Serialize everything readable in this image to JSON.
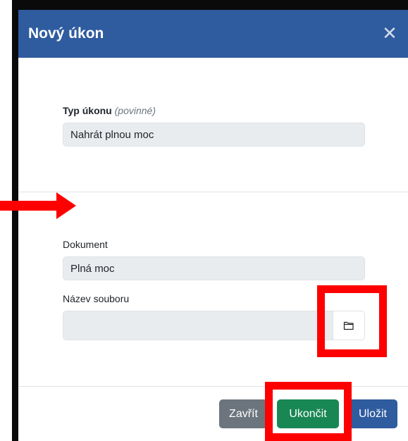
{
  "modal": {
    "title": "Nový úkon",
    "close_icon": "close-icon"
  },
  "action_type": {
    "label": "Typ úkonu",
    "required_hint": "(povinné)",
    "value": "Nahrát plnou moc"
  },
  "document": {
    "label": "Dokument",
    "value": "Plná moc"
  },
  "file_name": {
    "label": "Název souboru",
    "value": "",
    "browse_icon": "folder-icon"
  },
  "footer": {
    "close_label": "Zavřít",
    "finish_label": "Ukončit",
    "save_label": "Uložit"
  },
  "colors": {
    "header": "#2f5b9f",
    "finish": "#198754",
    "close": "#6c757d",
    "annotation": "#ff0000"
  }
}
